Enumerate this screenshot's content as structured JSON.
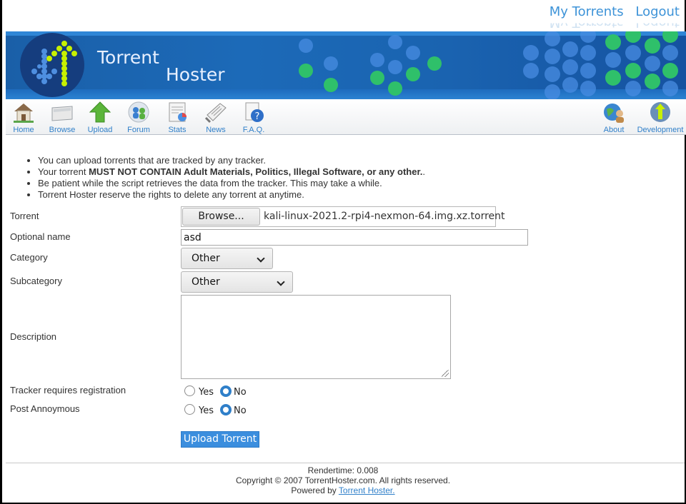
{
  "top_links": {
    "my_torrents": "My Torrents",
    "logout": "Logout"
  },
  "brand": {
    "line1": "Torrent",
    "line2": "Hoster"
  },
  "nav": {
    "items": [
      {
        "label": "Home",
        "icon": "house-icon"
      },
      {
        "label": "Browse",
        "icon": "folder-icon"
      },
      {
        "label": "Upload",
        "icon": "upload-arrow-icon"
      },
      {
        "label": "Forum",
        "icon": "forum-people-icon"
      },
      {
        "label": "Stats",
        "icon": "stats-chart-icon"
      },
      {
        "label": "News",
        "icon": "newspaper-icon"
      },
      {
        "label": "F.A.Q.",
        "icon": "faq-help-icon"
      },
      {
        "label": "About",
        "icon": "about-globe-icon"
      },
      {
        "label": "Development",
        "icon": "development-icon"
      }
    ]
  },
  "rules": {
    "r1": "You can upload torrents that are tracked by any tracker.",
    "r2_pre": "Your torrent ",
    "r2_bold": "MUST NOT CONTAIN Adult Materials, Politics, Illegal Software, or any other.",
    "r2_post": ".",
    "r3": "Be patient while the script retrieves the data from the tracker. This may take a while.",
    "r4": "Torrent Hoster reserve the rights to delete any torrent at anytime."
  },
  "form": {
    "torrent_label": "Torrent",
    "browse_label": "Browse...",
    "file_name": "kali-linux-2021.2-rpi4-nexmon-64.img.xz.torrent",
    "optional_name_label": "Optional name",
    "optional_name_value": "asd",
    "category_label": "Category",
    "category_value": "Other",
    "subcategory_label": "Subcategory",
    "subcategory_value": "Other",
    "description_label": "Description",
    "tracker_reg_label": "Tracker requires registration",
    "anon_label": "Post Annoymous",
    "yes": "Yes",
    "no": "No",
    "tracker_reg_selected": "No",
    "anon_selected": "No",
    "submit_label": "Upload Torrent"
  },
  "footer": {
    "rendertime": "Rendertime: 0.008",
    "copyright": "Copyright © 2007 TorrentHoster.com. All rights reserved.",
    "powered_pre": "Powered by ",
    "powered_link": "Torrent Hoster."
  },
  "colors": {
    "link": "#3d93d8",
    "banner": "#1a63b0",
    "dots_green": "#2fc06a",
    "button": "#3b8ede"
  }
}
